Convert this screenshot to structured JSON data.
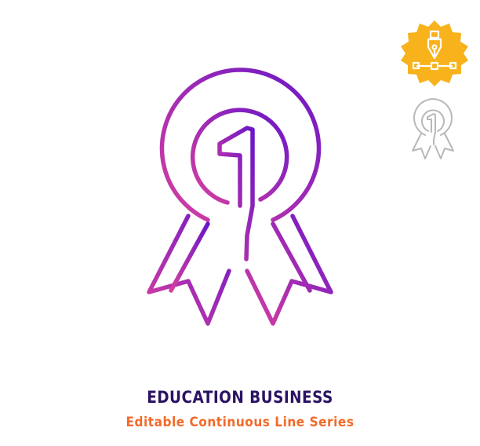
{
  "title": "EDUCATION BUSINESS",
  "subtitle": "Editable Continuous Line Series",
  "icons": {
    "main": "first-place-ribbon-icon",
    "badge": "pen-tool-vector-icon",
    "preview": "first-place-ribbon-outline-icon"
  },
  "colors": {
    "gradient_start": "#d63fa0",
    "gradient_end": "#6a16c8",
    "title": "#2a1364",
    "subtitle": "#f26a2a",
    "badge_fill": "#f8b21c",
    "preview_stroke": "#b8b8b8"
  }
}
